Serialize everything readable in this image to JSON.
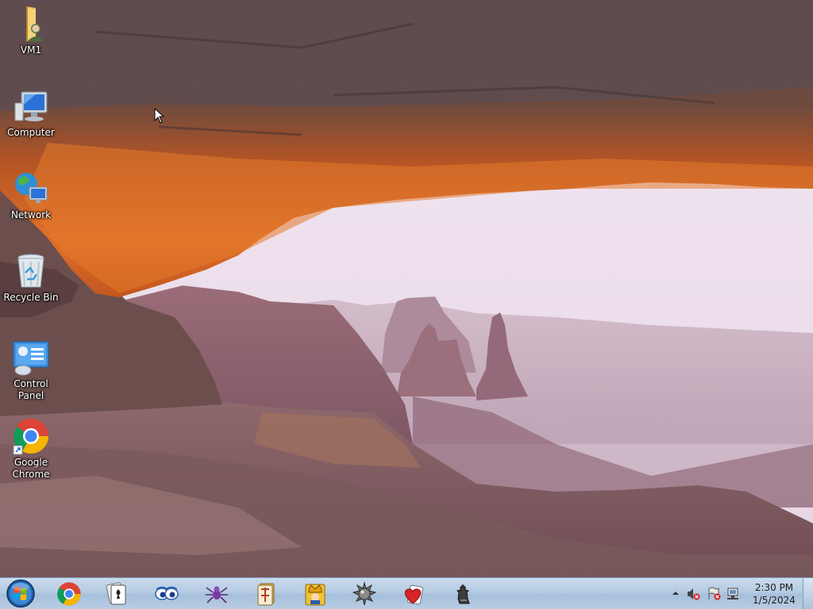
{
  "desktop": {
    "icons": [
      {
        "label": "VM1",
        "icon": "user-folder-icon"
      },
      {
        "label": "Computer",
        "icon": "computer-icon"
      },
      {
        "label": "Network",
        "icon": "network-icon"
      },
      {
        "label": "Recycle Bin",
        "icon": "recycle-bin-icon"
      },
      {
        "label": "Control Panel",
        "icon": "control-panel-icon"
      },
      {
        "label": "Google Chrome",
        "icon": "chrome-icon"
      }
    ]
  },
  "taskbar": {
    "pinned": [
      {
        "icon": "chrome-icon"
      },
      {
        "icon": "solitaire-icon"
      },
      {
        "icon": "purble-place-icon"
      },
      {
        "icon": "spider-solitaire-icon"
      },
      {
        "icon": "mahjong-icon"
      },
      {
        "icon": "freecell-icon"
      },
      {
        "icon": "minesweeper-icon"
      },
      {
        "icon": "hearts-icon"
      },
      {
        "icon": "chess-icon"
      }
    ],
    "tray": {
      "icons": [
        "show-hidden-icons-icon",
        "volume-muted-icon",
        "action-center-icon",
        "network-disconnected-icon"
      ],
      "time": "2:30 PM",
      "date": "1/5/2024"
    }
  },
  "colors": {
    "taskbar": "#b5cbe2",
    "arch_orange": "#d9651e",
    "sky": "#efe3ef"
  }
}
